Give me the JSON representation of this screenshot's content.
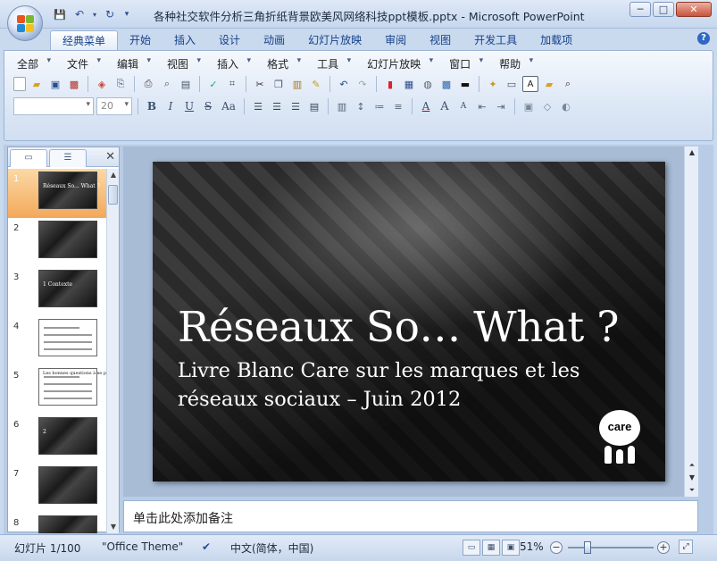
{
  "window": {
    "title": "各种社交软件分析三角折纸背景欧美风网络科技ppt模板.pptx - Microsoft PowerPoint",
    "minimize": "─",
    "maximize": "□",
    "close": "✕"
  },
  "quick_access": {
    "save": "💾",
    "undo": "↶",
    "redo": "↻",
    "customize": "▾"
  },
  "tabs": [
    "经典菜单",
    "开始",
    "插入",
    "设计",
    "动画",
    "幻灯片放映",
    "审阅",
    "视图",
    "开发工具",
    "加载项"
  ],
  "active_tab": "经典菜单",
  "help": "?",
  "menu": [
    "全部",
    "文件",
    "编辑",
    "视图",
    "插入",
    "格式",
    "工具",
    "幻灯片放映",
    "窗口",
    "帮助"
  ],
  "toolbar": {
    "font_name": "",
    "font_size": "20",
    "bold": "B",
    "italic": "I",
    "underline": "U",
    "strike": "S",
    "case": "Aa",
    "font_color": "A",
    "grow": "A",
    "shrink": "A",
    "text_box": "A"
  },
  "pane": {
    "slides_tab": "▭",
    "outline_tab": "☰",
    "close": "✕"
  },
  "thumbnails": [
    {
      "num": "1",
      "style": "dark",
      "label": "Réseaux So... What ?"
    },
    {
      "num": "2",
      "style": "dark",
      "label": ""
    },
    {
      "num": "3",
      "style": "dark",
      "label": "1 Contexte"
    },
    {
      "num": "4",
      "style": "white",
      "label": ""
    },
    {
      "num": "5",
      "style": "white",
      "label": "Les bonnes questions à se poser"
    },
    {
      "num": "6",
      "style": "dark",
      "label": "2"
    },
    {
      "num": "7",
      "style": "dark",
      "label": ""
    },
    {
      "num": "8",
      "style": "dark",
      "label": ""
    }
  ],
  "selected_thumb": "1",
  "slide": {
    "title": "Réseaux So… What ?",
    "subtitle": "Livre Blanc Care sur les marques et les réseaux sociaux – Juin 2012",
    "logo_text": "care"
  },
  "notes_placeholder": "单击此处添加备注",
  "status": {
    "slide_info": "幻灯片 1/100",
    "theme": "\"Office Theme\"",
    "language": "中文(简体，中国)",
    "zoom": "51%",
    "zoom_minus": "−",
    "zoom_plus": "+"
  }
}
